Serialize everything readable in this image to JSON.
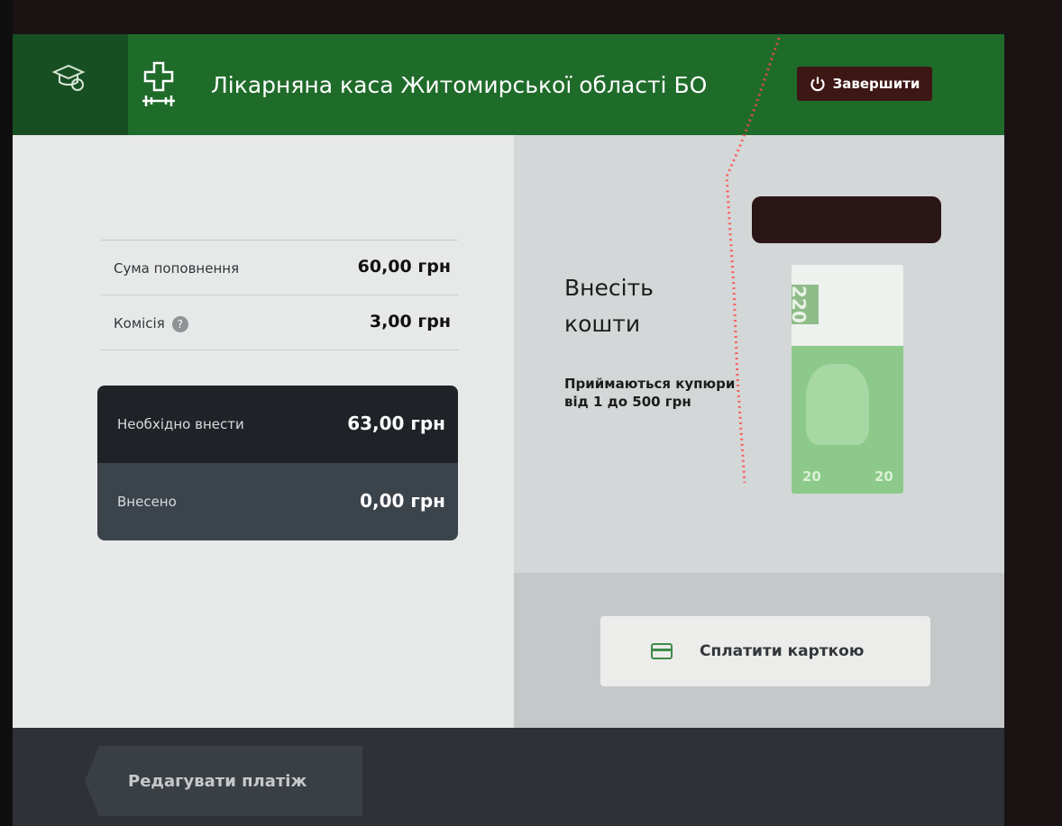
{
  "header": {
    "title": "Лікарняна каса Житомирської області БО",
    "finish_label": "Завершити",
    "accent": "#1f6b2a"
  },
  "summary": {
    "rows": [
      {
        "label": "Сума поповнення",
        "value": "60,00 грн"
      },
      {
        "label": "Комісія",
        "value": "3,00 грн"
      }
    ],
    "required": {
      "label": "Необхідно внести",
      "value": "63,00 грн"
    },
    "deposited": {
      "label": "Внесено",
      "value": "0,00 грн"
    }
  },
  "insert": {
    "title_line1": "Внесіть",
    "title_line2": "кошти",
    "note_line1": "Приймаються купюри",
    "note_line2": "від 1 до 500 грн"
  },
  "banknote": {
    "code": "220",
    "denomination": "20"
  },
  "actions": {
    "card_label": "Сплатити карткою",
    "edit_label": "Редагувати платіж"
  },
  "icons": {
    "cap": "graduation-cap-icon",
    "org": "medical-cross-icon",
    "power": "power-icon",
    "help": "help-icon",
    "card": "card-icon"
  }
}
